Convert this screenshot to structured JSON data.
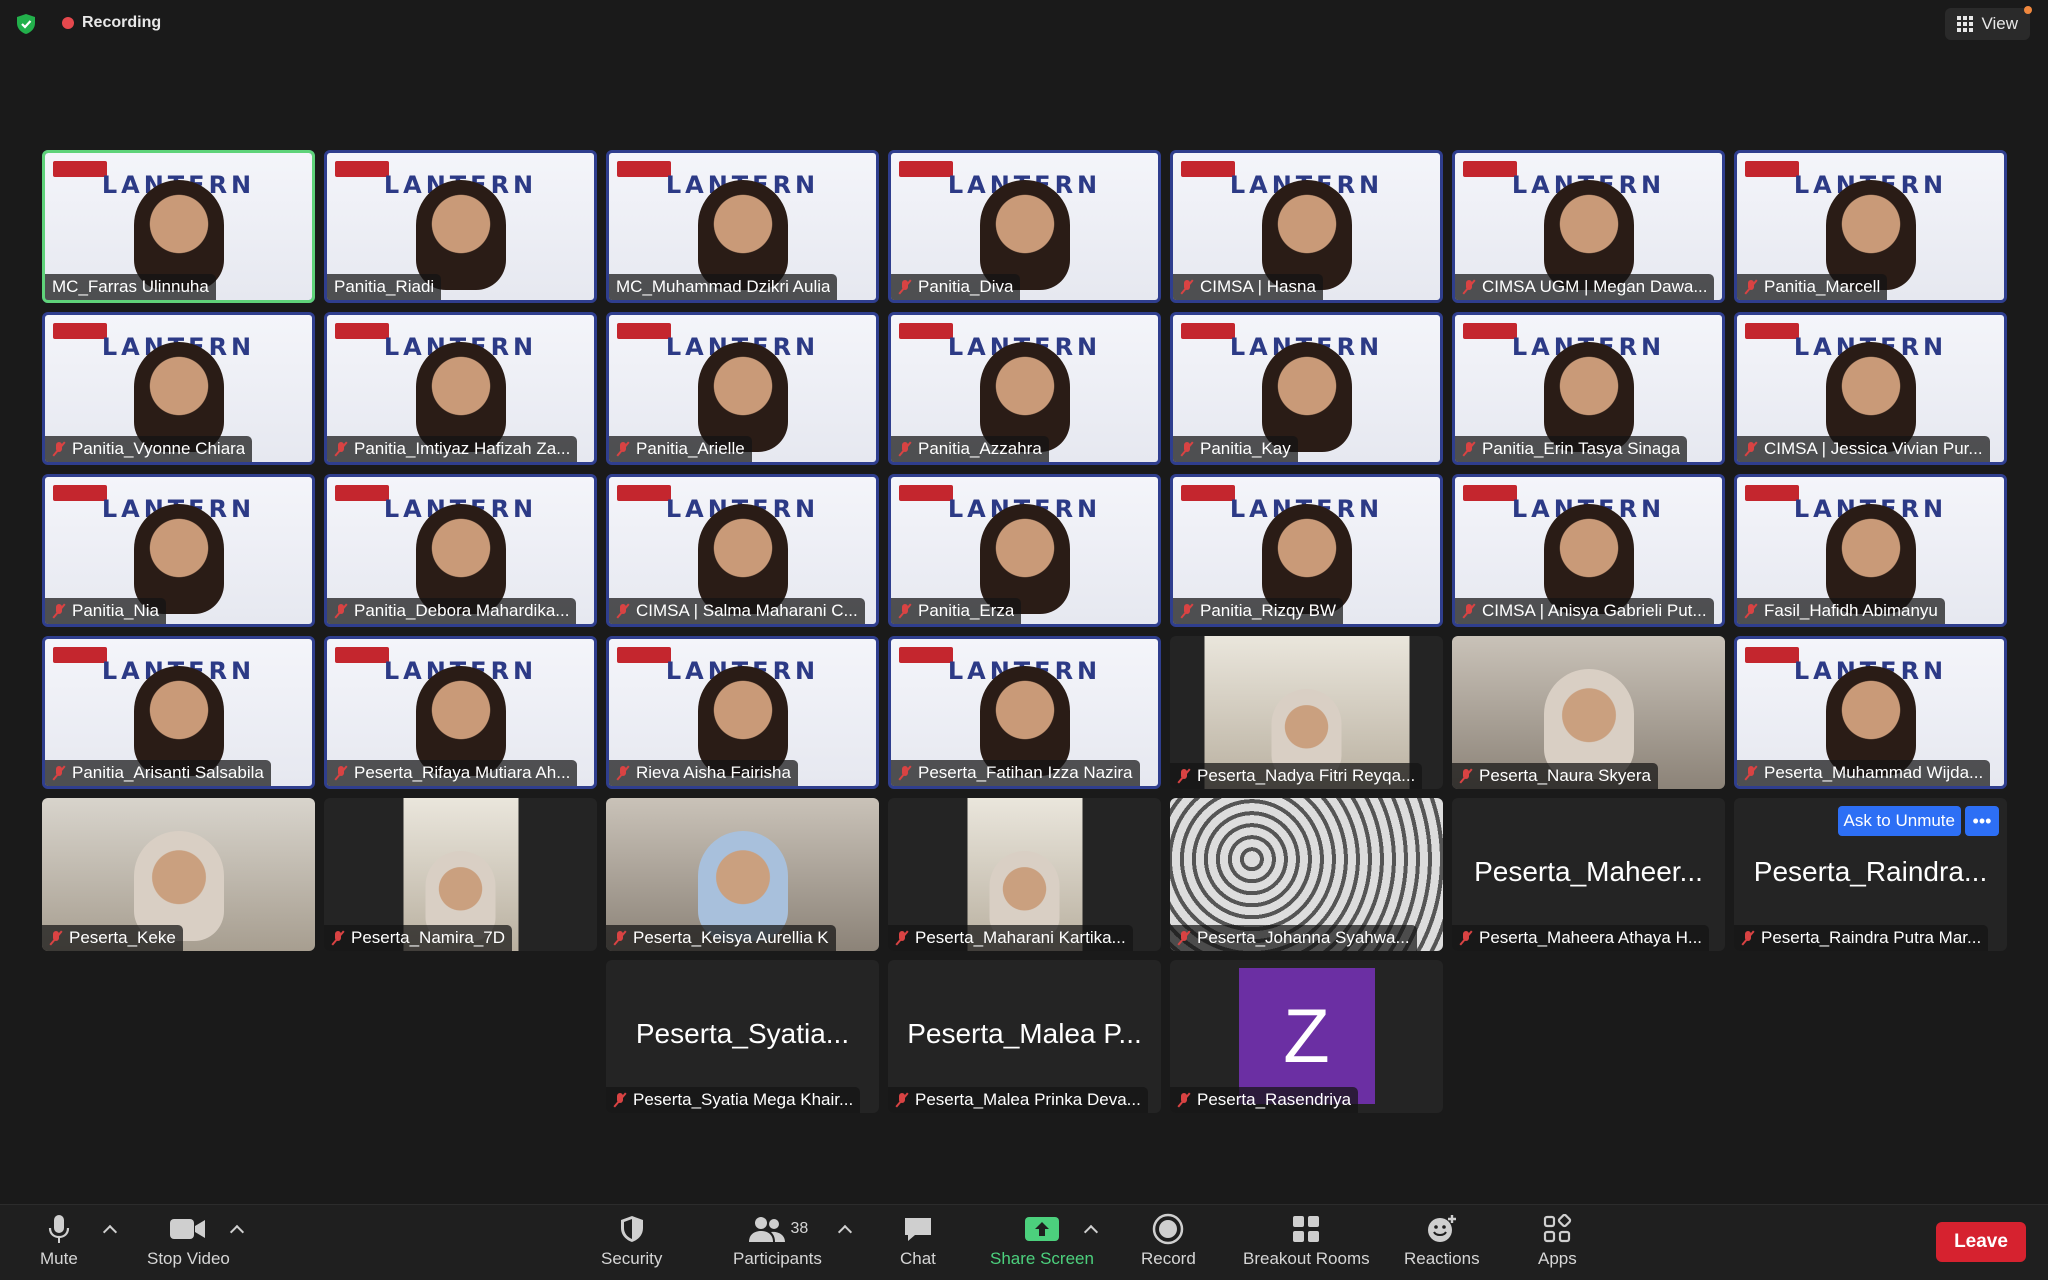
{
  "top_bar": {
    "recording_label": "Recording",
    "view_label": "View"
  },
  "gallery": {
    "rows": [
      [
        {
          "name": "MC_Farras Ulinnuha",
          "muted": false,
          "speaking": true,
          "style": "banner"
        },
        {
          "name": "Panitia_Riadi",
          "muted": false,
          "style": "banner"
        },
        {
          "name": "MC_Muhammad Dzikri Aulia",
          "muted": false,
          "style": "banner"
        },
        {
          "name": "Panitia_Diva",
          "muted": true,
          "style": "banner"
        },
        {
          "name": "CIMSA | Hasna",
          "muted": true,
          "style": "banner"
        },
        {
          "name": "CIMSA UGM | Megan Dawa...",
          "muted": true,
          "style": "banner"
        },
        {
          "name": "Panitia_Marcell",
          "muted": true,
          "style": "banner"
        }
      ],
      [
        {
          "name": "Panitia_Vyonne Chiara",
          "muted": true,
          "style": "banner"
        },
        {
          "name": "Panitia_Imtiyaz Hafizah Za...",
          "muted": true,
          "style": "banner"
        },
        {
          "name": "Panitia_Arielle",
          "muted": true,
          "style": "banner"
        },
        {
          "name": "Panitia_Azzahra",
          "muted": true,
          "style": "banner"
        },
        {
          "name": "Panitia_Kay",
          "muted": true,
          "style": "banner"
        },
        {
          "name": "Panitia_Erin Tasya Sinaga",
          "muted": true,
          "style": "banner"
        },
        {
          "name": "CIMSA | Jessica Vivian Pur...",
          "muted": true,
          "style": "banner"
        }
      ],
      [
        {
          "name": "Panitia_Nia",
          "muted": true,
          "style": "banner"
        },
        {
          "name": "Panitia_Debora Mahardika...",
          "muted": true,
          "style": "banner"
        },
        {
          "name": "CIMSA | Salma Maharani C...",
          "muted": true,
          "style": "banner"
        },
        {
          "name": "Panitia_Erza",
          "muted": true,
          "style": "banner"
        },
        {
          "name": "Panitia_Rizqy BW",
          "muted": true,
          "style": "banner"
        },
        {
          "name": "CIMSA | Anisya Gabrieli Put...",
          "muted": true,
          "style": "banner"
        },
        {
          "name": "Fasil_Hafidh Abimanyu",
          "muted": true,
          "style": "banner"
        }
      ],
      [
        {
          "name": "Panitia_Arisanti Salsabila",
          "muted": true,
          "style": "banner"
        },
        {
          "name": "Peserta_Rifaya Mutiara Ah...",
          "muted": true,
          "style": "banner"
        },
        {
          "name": "Rieva Aisha Fairisha",
          "muted": true,
          "style": "banner"
        },
        {
          "name": "Peserta_Fatihan Izza Nazira",
          "muted": true,
          "style": "banner"
        },
        {
          "name": "Peserta_Nadya Fitri Reyqa...",
          "muted": true,
          "style": "inset"
        },
        {
          "name": "Peserta_Naura Skyera",
          "muted": true,
          "style": "photo"
        },
        {
          "name": "Peserta_Muhammad Wijda...",
          "muted": true,
          "style": "banner"
        }
      ],
      [
        {
          "name": "Peserta_Keke",
          "muted": true,
          "style": "room"
        },
        {
          "name": "Peserta_Namira_7D",
          "muted": true,
          "style": "inset"
        },
        {
          "name": "Peserta_Keisya Aurellia K",
          "muted": true,
          "style": "photo"
        },
        {
          "name": "Peserta_Maharani Kartika...",
          "muted": true,
          "style": "inset"
        },
        {
          "name": "Peserta_Johanna Syahwa...",
          "muted": true,
          "style": "pattern"
        },
        {
          "name": "Peserta_Maheera Athaya H...",
          "muted": true,
          "style": "noVideo",
          "big_name": "Peserta_Maheer..."
        },
        {
          "name": "Peserta_Raindra Putra Mar...",
          "muted": true,
          "style": "noVideo",
          "big_name": "Peserta_Raindra...",
          "ask_unmute": true
        }
      ],
      [
        {
          "name": "Peserta_Syatia Mega Khair...",
          "muted": true,
          "style": "noVideo",
          "big_name": "Peserta_Syatia..."
        },
        {
          "name": "Peserta_Malea Prinka Deva...",
          "muted": true,
          "style": "noVideo",
          "big_name": "Peserta_Malea P..."
        },
        {
          "name": "Peserta_Rasendriya",
          "muted": true,
          "style": "avatar",
          "avatar_letter": "Z"
        }
      ]
    ],
    "banner_logo": "LANTERN",
    "ask_unmute_label": "Ask to Unmute",
    "more_label": "•••"
  },
  "toolbar": {
    "mute": "Mute",
    "stop_video": "Stop Video",
    "security": "Security",
    "participants": "Participants",
    "participants_count": "38",
    "chat": "Chat",
    "share_screen": "Share Screen",
    "record": "Record",
    "breakout_rooms": "Breakout Rooms",
    "reactions": "Reactions",
    "apps": "Apps",
    "leave": "Leave"
  },
  "colors": {
    "accent_green": "#4cd07d",
    "leave_red": "#d6222f",
    "unmute_blue": "#2d6ff5",
    "avatar_purple": "#6b2fa3"
  }
}
